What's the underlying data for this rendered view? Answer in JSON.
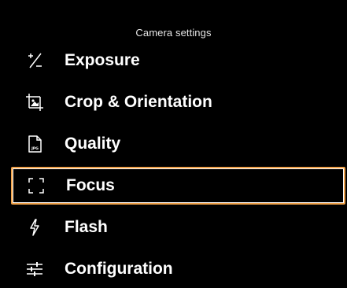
{
  "header": {
    "title": "Camera settings"
  },
  "menu": {
    "items": [
      {
        "label": "Exposure",
        "icon": "exposure-plus-minus-icon",
        "selected": false
      },
      {
        "label": "Crop & Orientation",
        "icon": "crop-image-icon",
        "selected": false
      },
      {
        "label": "Quality",
        "icon": "jpg-file-icon",
        "selected": false
      },
      {
        "label": "Focus",
        "icon": "focus-brackets-icon",
        "selected": true
      },
      {
        "label": "Flash",
        "icon": "flash-icon",
        "selected": false
      },
      {
        "label": "Configuration",
        "icon": "sliders-icon",
        "selected": false
      }
    ]
  },
  "colors": {
    "background": "#000000",
    "text": "#ffffff",
    "selection_border": "#f0a24a"
  }
}
